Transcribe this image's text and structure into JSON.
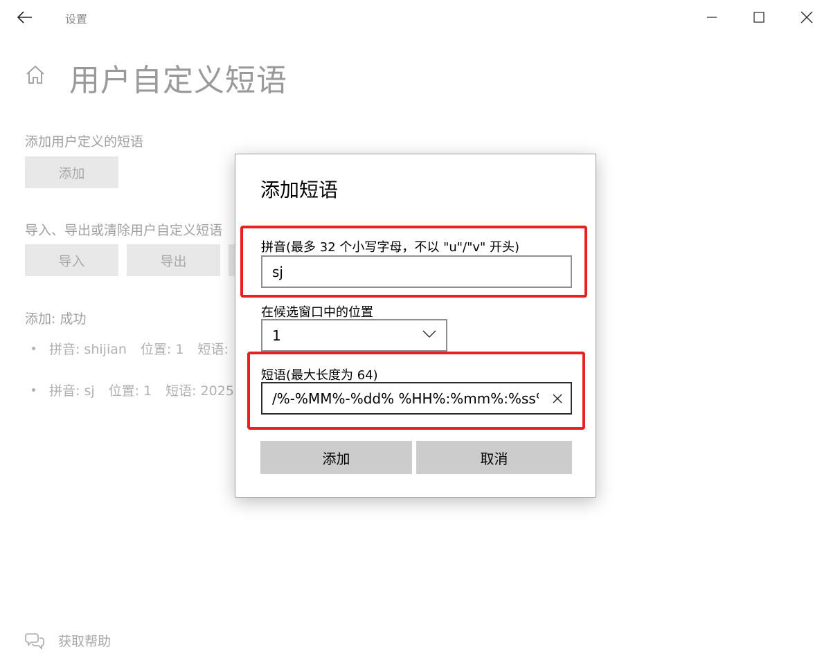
{
  "window": {
    "title": "设置"
  },
  "page": {
    "title": "用户自定义短语",
    "add_section_label": "添加用户定义的短语",
    "add_button": "添加",
    "manage_section_label": "导入、导出或清除用户自定义短语",
    "import_button": "导入",
    "export_button": "导出",
    "status": "添加: 成功",
    "phrases": [
      {
        "pinyin": "拼音: shijian",
        "position": "位置: 1",
        "phrase": "短语:"
      },
      {
        "pinyin": "拼音: sj",
        "position": "位置: 1",
        "phrase": "短语: 2025"
      }
    ],
    "help_label": "获取帮助"
  },
  "dialog": {
    "title": "添加短语",
    "pinyin_label": "拼音(最多 32 个小写字母，不以 \"u\"/\"v\" 开头)",
    "pinyin_value": "sj",
    "position_label": "在候选窗口中的位置",
    "position_value": "1",
    "phrase_label": "短语(最大长度为 64)",
    "phrase_value": "/%-%MM%-%dd% %HH%:%mm%:%ss%",
    "add_button": "添加",
    "cancel_button": "取消"
  },
  "colors": {
    "annotation": "#e8201f",
    "dialog_button": "#cccccc",
    "background_button": "#e8e8e8"
  }
}
